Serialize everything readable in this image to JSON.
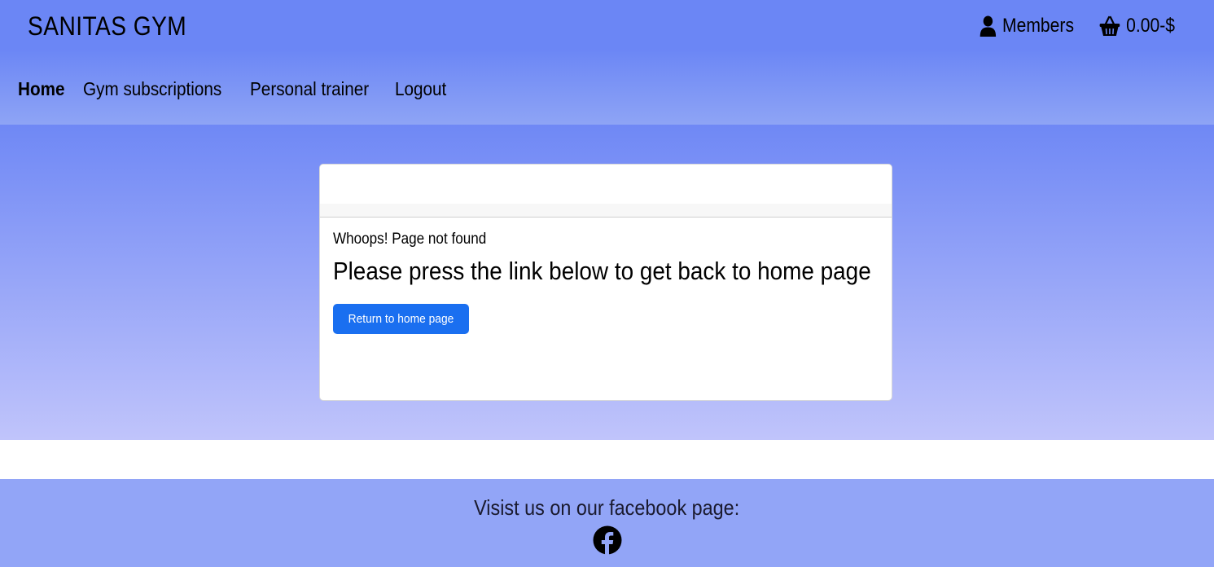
{
  "header": {
    "brand": "SANITAS GYM",
    "members_label": "Members",
    "cart_total": "0.00-$"
  },
  "nav": {
    "items": [
      {
        "label": "Home",
        "active": true
      },
      {
        "label": "Gym subscriptions"
      },
      {
        "label": "Personal trainer"
      },
      {
        "label": "Logout"
      }
    ]
  },
  "card": {
    "subtitle": "Whoops! Page not found",
    "title": "Please press the link below to get back to home page",
    "button_label": "Return to home page"
  },
  "footer": {
    "text": "Visist us on our facebook page:",
    "icon": "facebook-icon"
  },
  "colors": {
    "header": "#6b86f5",
    "button": "#1a6ff0",
    "footer": "#92a5f7"
  }
}
